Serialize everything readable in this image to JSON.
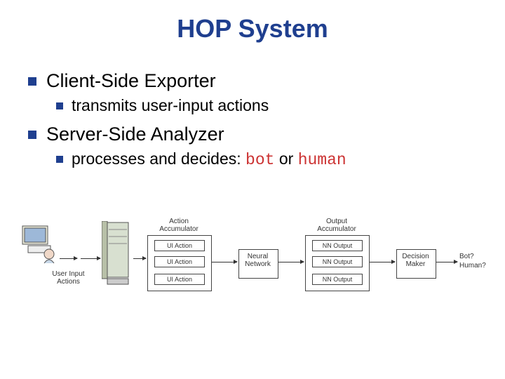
{
  "title": "HOP System",
  "bullets": {
    "clientExporter": "Client-Side Exporter",
    "clientSub": "transmits user-input actions",
    "serverAnalyzer": "Server-Side Analyzer",
    "serverSubPrefix": "processes and decides: ",
    "serverSubBot": "bot",
    "serverSubOr": " or ",
    "serverSubHuman": "human"
  },
  "diagram": {
    "userInputActions": "User Input\nActions",
    "actionAccumulator": "Action\nAccumulator",
    "uiAction": "UI Action",
    "neuralNetwork": "Neural\nNetwork",
    "outputAccumulator": "Output\nAccumulator",
    "nnOutput": "NN Output",
    "decisionMaker": "Decision\nMaker",
    "resultBot": "Bot?",
    "resultHuman": "Human?"
  }
}
